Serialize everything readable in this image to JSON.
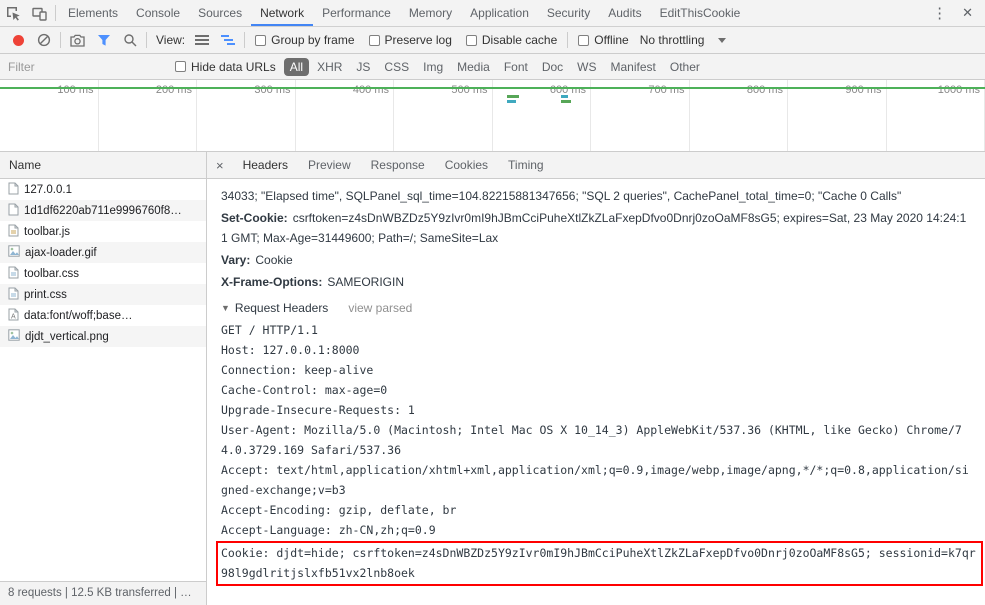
{
  "colors": {
    "accent_blue": "#4285f4",
    "record_red": "#ee4237",
    "timeline_green": "#4db159",
    "highlight_red": "#ff0000",
    "active_filter_badge": "#6e6e6e"
  },
  "devtools_tabs": {
    "items": [
      "Elements",
      "Console",
      "Sources",
      "Network",
      "Performance",
      "Memory",
      "Application",
      "Security",
      "Audits",
      "EditThisCookie"
    ],
    "active": "Network",
    "more_menu": "⋮",
    "close": "✕"
  },
  "toolbar": {
    "view_label": "View:",
    "group_by_frame": "Group by frame",
    "preserve_log": "Preserve log",
    "disable_cache": "Disable cache",
    "offline": "Offline",
    "throttling": "No throttling"
  },
  "filter_bar": {
    "placeholder": "Filter",
    "hide_data_urls": "Hide data URLs",
    "types": [
      "All",
      "XHR",
      "JS",
      "CSS",
      "Img",
      "Media",
      "Font",
      "Doc",
      "WS",
      "Manifest",
      "Other"
    ],
    "active_type": "All"
  },
  "timeline": {
    "ticks": [
      "100 ms",
      "200 ms",
      "300 ms",
      "400 ms",
      "500 ms",
      "600 ms",
      "700 ms",
      "800 ms",
      "900 ms",
      "1000 ms"
    ]
  },
  "requests": {
    "header": "Name",
    "items": [
      {
        "name": "127.0.0.1",
        "icon": "document-icon"
      },
      {
        "name": "1d1df6220ab711e9996760f8…",
        "icon": "document-icon"
      },
      {
        "name": "toolbar.js",
        "icon": "script-icon"
      },
      {
        "name": "ajax-loader.gif",
        "icon": "image-icon"
      },
      {
        "name": "toolbar.css",
        "icon": "stylesheet-icon"
      },
      {
        "name": "print.css",
        "icon": "stylesheet-icon"
      },
      {
        "name": "data:font/woff;base…",
        "icon": "font-icon"
      },
      {
        "name": "djdt_vertical.png",
        "icon": "image-icon"
      }
    ]
  },
  "status_bar": {
    "text": "8 requests | 12.5 KB transferred | …"
  },
  "details": {
    "tabs": [
      "Headers",
      "Preview",
      "Response",
      "Cookies",
      "Timing"
    ],
    "active_tab": "Headers",
    "close": "×",
    "overflow_line": "34033; \"Elapsed time\", SQLPanel_sql_time=104.82215881347656; \"SQL 2 queries\", CachePanel_total_time=0; \"Cache 0 Calls\"",
    "response_headers": [
      {
        "name": "Set-Cookie:",
        "value": "csrftoken=z4sDnWBZDz5Y9zIvr0mI9hJBmCciPuheXtlZkZLaFxepDfvo0Dnrj0zoOaMF8sG5; expires=Sat, 23 May 2020 14:24:11 GMT; Max-Age=31449600; Path=/; SameSite=Lax"
      },
      {
        "name": "Vary:",
        "value": "Cookie"
      },
      {
        "name": "X-Frame-Options:",
        "value": "SAMEORIGIN"
      }
    ],
    "section_title": "Request Headers",
    "view_parsed": "view parsed",
    "request_lines": [
      "GET / HTTP/1.1",
      "Host: 127.0.0.1:8000",
      "Connection: keep-alive",
      "Cache-Control: max-age=0",
      "Upgrade-Insecure-Requests: 1",
      "User-Agent: Mozilla/5.0 (Macintosh; Intel Mac OS X 10_14_3) AppleWebKit/537.36 (KHTML, like Gecko) Chrome/74.0.3729.169 Safari/537.36",
      "Accept: text/html,application/xhtml+xml,application/xml;q=0.9,image/webp,image/apng,*/*;q=0.8,application/signed-exchange;v=b3",
      "Accept-Encoding: gzip, deflate, br",
      "Accept-Language: zh-CN,zh;q=0.9"
    ],
    "cookie_line": "Cookie: djdt=hide; csrftoken=z4sDnWBZDz5Y9zIvr0mI9hJBmCciPuheXtlZkZLaFxepDfvo0Dnrj0zoOaMF8sG5; sessionid=k7qr98l9gdlritjslxfb51vx2lnb8oek"
  }
}
